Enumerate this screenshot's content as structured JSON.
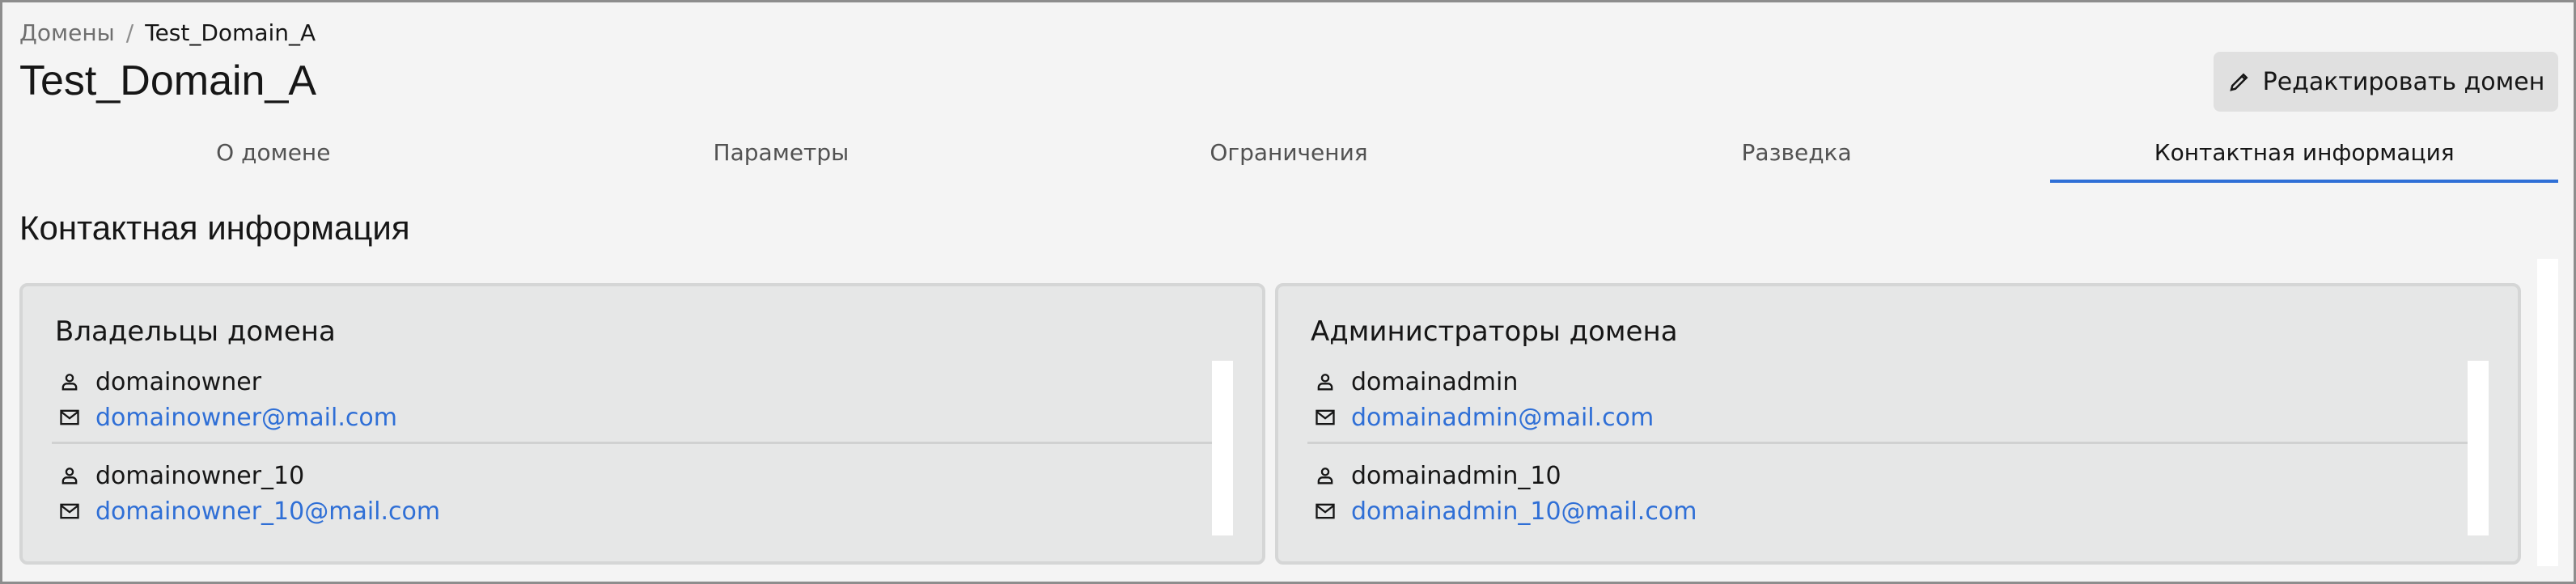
{
  "breadcrumb": {
    "parent": "Домены",
    "separator": "/",
    "current": "Test_Domain_A"
  },
  "page": {
    "title": "Test_Domain_A"
  },
  "edit_button": {
    "label": "Редактировать домен",
    "icon": "pencil-icon"
  },
  "tabs": [
    {
      "label": "О домене"
    },
    {
      "label": "Параметры"
    },
    {
      "label": "Ограничения"
    },
    {
      "label": "Разведка"
    },
    {
      "label": "Контактная информация",
      "active": true
    }
  ],
  "section": {
    "title": "Контактная информация"
  },
  "owners": {
    "title": "Владельцы домена",
    "contacts": [
      {
        "name": "domainowner",
        "email": "domainowner@mail.com"
      },
      {
        "name": "domainowner_10",
        "email": "domainowner_10@mail.com"
      }
    ]
  },
  "admins": {
    "title": "Администраторы домена",
    "contacts": [
      {
        "name": "domainadmin",
        "email": "domainadmin@mail.com"
      },
      {
        "name": "domainadmin_10",
        "email": "domainadmin_10@mail.com"
      }
    ]
  },
  "colors": {
    "accent": "#2f6fd6",
    "background": "#f4f4f4",
    "card": "#e6e7e7"
  },
  "icons": {
    "user": "user-icon",
    "email": "mail-icon"
  }
}
